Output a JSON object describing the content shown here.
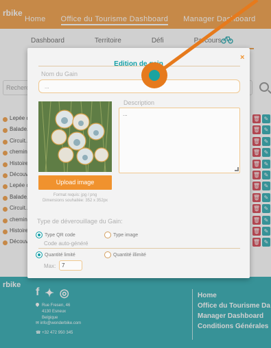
{
  "header": {
    "brand": "rbike",
    "nav": [
      "Home",
      "Office du Tourisme Dashboard",
      "Manager Dashboard"
    ]
  },
  "subtabs": [
    "Dashboard",
    "Territoire",
    "Défi",
    "Parcours"
  ],
  "search": {
    "placeholder": "Recherche"
  },
  "list_rows": [
    "Lepée d...",
    "Balade...",
    "Circuit...",
    "chemin...",
    "Histoire...",
    "Découve...",
    "Lepée d...",
    "Balade...",
    "Circuit...",
    "chemin...",
    "Histoire...",
    "Découve..."
  ],
  "modal": {
    "title": "Edition de gain",
    "close": "×",
    "gain_label": "Nom du Gain",
    "gain_placeholder": "...",
    "description_label": "Description",
    "description_placeholder": "...",
    "upload_label": "Upload image",
    "format_note_1": "Format requis: jpg / png",
    "format_note_2": "Dimensions souhaitée: 352 x 352px",
    "unlock_label": "Type de déverouillage du Gain:",
    "qr_label": "Type QR code",
    "image_label": "Type image",
    "auto_code_label": "Code auto-généré",
    "limited_label": "Quantité limité",
    "unlimited_label": "Quantité illimité",
    "max_label": "Max:",
    "max_value": "7"
  },
  "footer": {
    "brand": "rbike",
    "address_1": "Rue Fresen, 46",
    "address_2": "4130 Esneux",
    "address_3": "Belgique",
    "email": "info@wonderbike.com",
    "phone": "+32 472 950 345",
    "links": [
      "Home",
      "Office du Tourisme Da",
      "Manager Dashboard",
      "Conditions Générales"
    ]
  },
  "colors": {
    "orange": "#f0922e",
    "teal": "#14a0a8",
    "red": "#d32d3d"
  }
}
